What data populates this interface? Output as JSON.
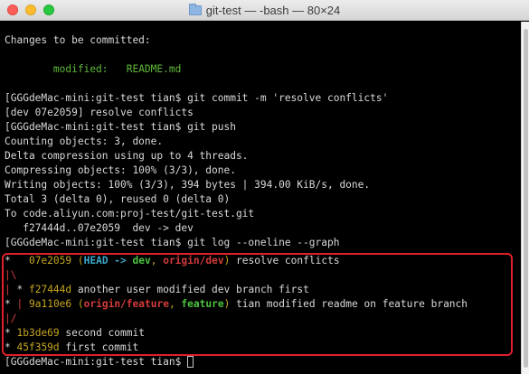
{
  "window": {
    "title": "git-test — -bash — 80×24"
  },
  "terminal": {
    "l1": "Changes to be committed:",
    "l2a": "        modified:   ",
    "l2b": "README.md",
    "l3": "[GGGdeMac-mini:git-test tian$ git commit -m 'resolve conflicts'",
    "l4": "[dev 07e2059] resolve conflicts",
    "l5": "[GGGdeMac-mini:git-test tian$ git push",
    "l6": "Counting objects: 3, done.",
    "l7": "Delta compression using up to 4 threads.",
    "l8": "Compressing objects: 100% (3/3), done.",
    "l9": "Writing objects: 100% (3/3), 394 bytes | 394.00 KiB/s, done.",
    "l10": "Total 3 (delta 0), reused 0 (delta 0)",
    "l11": "To code.aliyun.com:proj-test/git-test.git",
    "l12": "   f27444d..07e2059  dev -> dev",
    "l13": "[GGGdeMac-mini:git-test tian$ git log --oneline --graph",
    "g1": {
      "star": "*",
      "pad": "   ",
      "hash": "07e2059",
      "open": " (",
      "head": "HEAD -> ",
      "dev": "dev",
      "comma": ", ",
      "origin": "origin/dev",
      "close": ")",
      "msg": " resolve conflicts"
    },
    "g2": "|\\",
    "g3": {
      "bar": "| ",
      "star": "*",
      "sp": " ",
      "hash": "f27444d",
      "msg": " another user modified dev branch first"
    },
    "g4": {
      "star": "*",
      "sp": " ",
      "bar": "|",
      "sp2": " ",
      "hash": "9a110e6",
      "open": " (",
      "origin": "origin/feature",
      "comma": ", ",
      "feature": "feature",
      "close": ")",
      "msg": " tian modified readme on feature branch"
    },
    "g5": "|/",
    "g6": {
      "star": "*",
      "sp": " ",
      "hash": "1b3de69",
      "msg": " second commit"
    },
    "g7": {
      "star": "*",
      "sp": " ",
      "hash": "45f359d",
      "msg": " first commit"
    },
    "prompt": "[GGGdeMac-mini:git-test tian$ "
  },
  "colors": {
    "green": "#5fb93a",
    "yellow": "#c6a61f",
    "cyan": "#3aa6c9",
    "red": "#d33b3b",
    "highlight": "#e0202b"
  }
}
